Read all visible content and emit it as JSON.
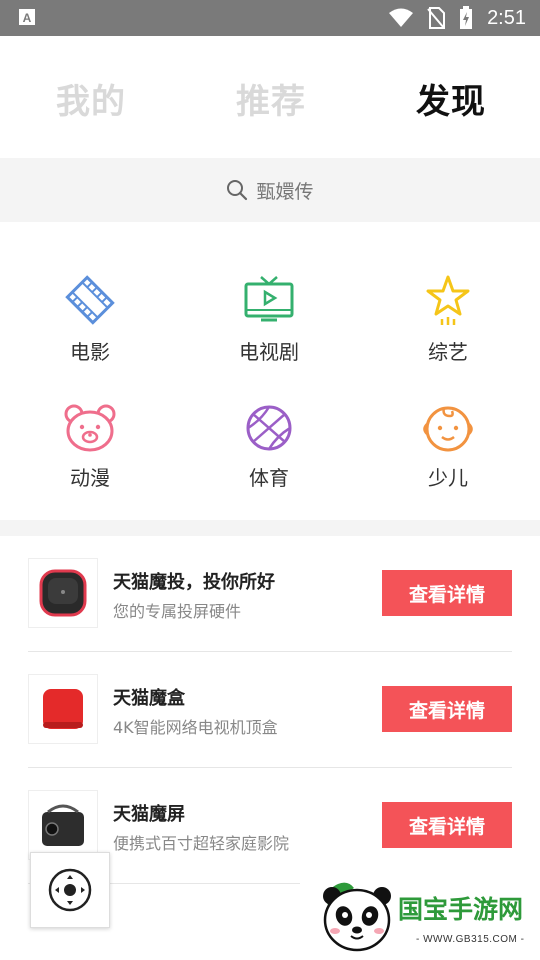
{
  "status_bar": {
    "time": "2:51"
  },
  "tabs": [
    {
      "label": "我的",
      "active": false
    },
    {
      "label": "推荐",
      "active": false
    },
    {
      "label": "发现",
      "active": true
    }
  ],
  "search": {
    "placeholder": "甄嬛传"
  },
  "categories": [
    {
      "label": "电影",
      "icon": "film-icon",
      "color": "#5b8fdb"
    },
    {
      "label": "电视剧",
      "icon": "tv-icon",
      "color": "#34b06e"
    },
    {
      "label": "综艺",
      "icon": "star-icon",
      "color": "#f5c518"
    },
    {
      "label": "动漫",
      "icon": "bear-icon",
      "color": "#ef6e8c"
    },
    {
      "label": "体育",
      "icon": "basketball-icon",
      "color": "#9b5fc7"
    },
    {
      "label": "少儿",
      "icon": "baby-face-icon",
      "color": "#f29340"
    }
  ],
  "products": [
    {
      "title": "天猫魔投，投你所好",
      "subtitle": "您的专属投屏硬件",
      "button": "查看详情",
      "image": "projector-image"
    },
    {
      "title": "天猫魔盒",
      "subtitle": "4K智能网络电视机顶盒",
      "button": "查看详情",
      "image": "red-box-image"
    },
    {
      "title": "天猫魔屏",
      "subtitle": "便携式百寸超轻家庭影院",
      "button": "查看详情",
      "image": "portable-projector-image"
    }
  ],
  "watermark": {
    "brand": "国宝手游网",
    "url": "- WWW.GB315.COM -"
  },
  "colors": {
    "accent_button": "#f45358",
    "status_bar": "#7a7a7a"
  }
}
